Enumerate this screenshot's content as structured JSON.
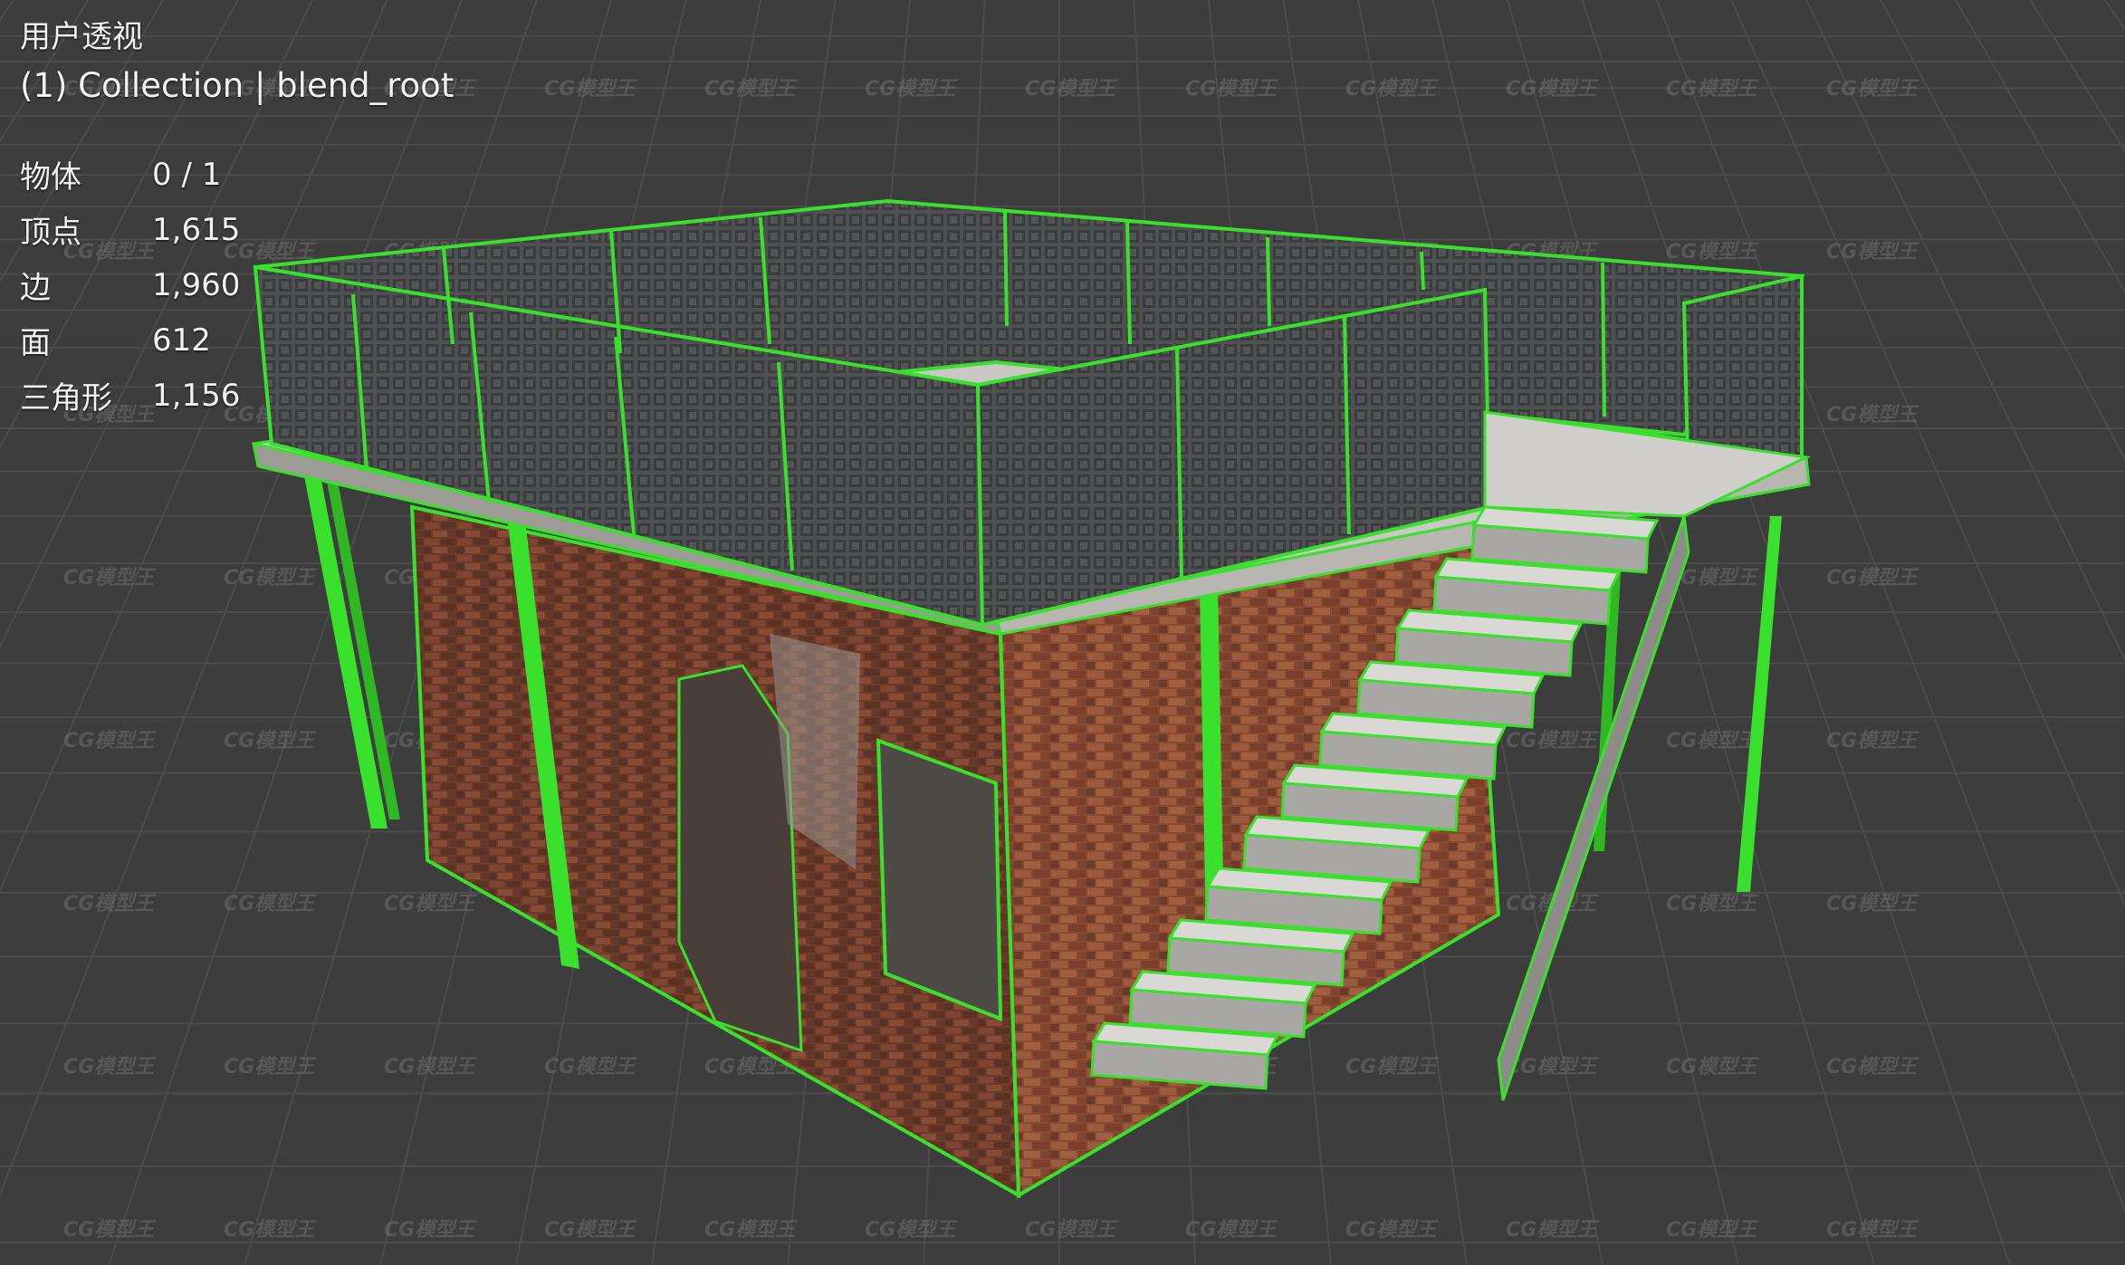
{
  "viewport": {
    "view_name": "用户透视",
    "collection": "(1) Collection | blend_root",
    "stats": [
      {
        "label": "物体",
        "value": "0 / 1"
      },
      {
        "label": "顶点",
        "value": "1,615"
      },
      {
        "label": "边",
        "value": "1,960"
      },
      {
        "label": "面",
        "value": "612"
      },
      {
        "label": "三角形",
        "value": "1,156"
      }
    ]
  },
  "watermark": {
    "text": "CG模型王"
  },
  "colors": {
    "background": "#3d3d3d",
    "grid": "#4a4a4a",
    "wire": "#39e02c",
    "brick": "#8a4a32",
    "concrete": "#bdbdb8",
    "fence": "#5a5a5a"
  }
}
